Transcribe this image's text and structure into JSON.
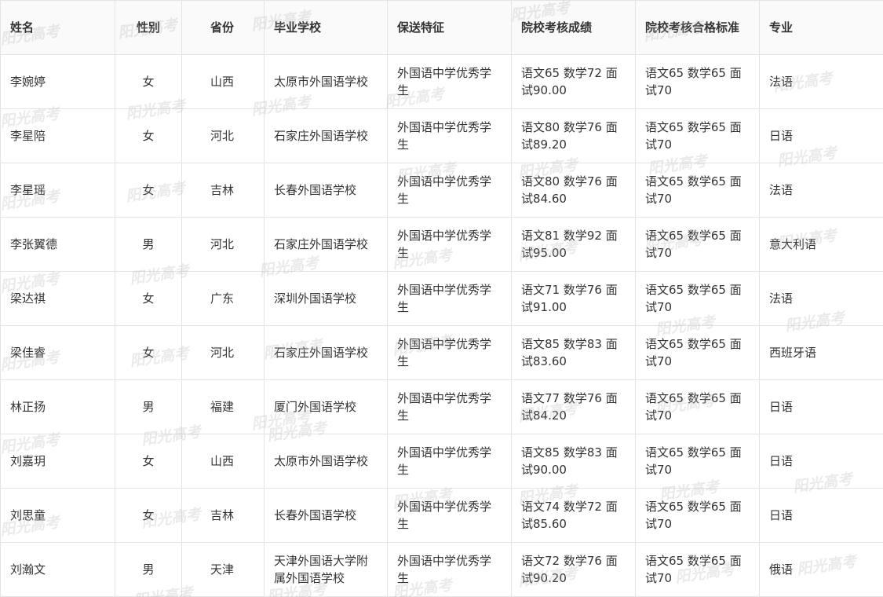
{
  "watermark": "阳光高考",
  "headers": [
    "姓名",
    "性别",
    "省份",
    "毕业学校",
    "保送特征",
    "院校考核成绩",
    "院校考核合格标准",
    "专业"
  ],
  "rows": [
    [
      "李婉婷",
      "女",
      "山西",
      "太原市外国语学校",
      "外国语中学优秀学生",
      "语文65 数学72 面试90.00",
      "语文65 数学65 面试70",
      "法语"
    ],
    [
      "李星陪",
      "女",
      "河北",
      "石家庄外国语学校",
      "外国语中学优秀学生",
      "语文80 数学76 面试89.20",
      "语文65 数学65 面试70",
      "日语"
    ],
    [
      "李星瑶",
      "女",
      "吉林",
      "长春外国语学校",
      "外国语中学优秀学生",
      "语文80 数学76 面试84.60",
      "语文65 数学65 面试70",
      "法语"
    ],
    [
      "李张翼德",
      "男",
      "河北",
      "石家庄外国语学校",
      "外国语中学优秀学生",
      "语文81 数学92 面试95.00",
      "语文65 数学65 面试70",
      "意大利语"
    ],
    [
      "梁达祺",
      "女",
      "广东",
      "深圳外国语学校",
      "外国语中学优秀学生",
      "语文71 数学76 面试91.00",
      "语文65 数学65 面试70",
      "法语"
    ],
    [
      "梁佳睿",
      "女",
      "河北",
      "石家庄外国语学校",
      "外国语中学优秀学生",
      "语文85 数学83 面试83.60",
      "语文65 数学65 面试70",
      "西班牙语"
    ],
    [
      "林正扬",
      "男",
      "福建",
      "厦门外国语学校",
      "外国语中学优秀学生",
      "语文77 数学76 面试84.20",
      "语文65 数学65 面试70",
      "日语"
    ],
    [
      "刘嘉玥",
      "女",
      "山西",
      "太原市外国语学校",
      "外国语中学优秀学生",
      "语文85 数学83 面试90.00",
      "语文65 数学65 面试70",
      "日语"
    ],
    [
      "刘思童",
      "女",
      "吉林",
      "长春外国语学校",
      "外国语中学优秀学生",
      "语文74 数学72 面试85.60",
      "语文65 数学65 面试70",
      "日语"
    ],
    [
      "刘瀚文",
      "男",
      "天津",
      "天津外国语大学附属外国语学校",
      "外国语中学优秀学生",
      "语文72 数学76 面试90.20",
      "语文65 数学65 面试70",
      "俄语"
    ]
  ]
}
